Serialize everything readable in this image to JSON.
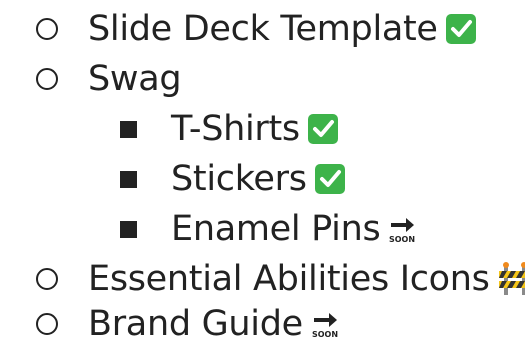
{
  "outline": {
    "items": [
      {
        "label": "Slide Deck Template",
        "level": 2,
        "bullet": "hollow-circle",
        "status_icon": "check-mark-button-icon"
      },
      {
        "label": "Swag",
        "level": 2,
        "bullet": "hollow-circle",
        "status_icon": ""
      },
      {
        "label": "T-Shirts",
        "level": 3,
        "bullet": "filled-square",
        "status_icon": "check-mark-button-icon"
      },
      {
        "label": "Stickers",
        "level": 3,
        "bullet": "filled-square",
        "status_icon": "check-mark-button-icon"
      },
      {
        "label": "Enamel Pins",
        "level": 3,
        "bullet": "filled-square",
        "status_icon": "soon-arrow-icon"
      },
      {
        "label": "Essential Abilities Icons",
        "level": 2,
        "bullet": "hollow-circle",
        "status_icon": "construction-icon"
      },
      {
        "label": "Brand Guide",
        "level": 2,
        "bullet": "hollow-circle",
        "status_icon": "soon-arrow-icon"
      }
    ]
  },
  "icons": {
    "soon_text": "SOON"
  },
  "colors": {
    "text": "#222222",
    "check_green": "#3db34a",
    "construction_yellow": "#f5c518"
  }
}
